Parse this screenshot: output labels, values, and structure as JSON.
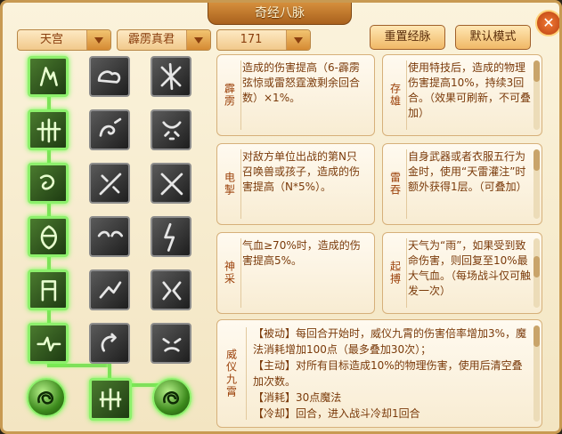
{
  "window": {
    "title": "奇经八脉",
    "close_symbol": "✕"
  },
  "toolbar": {
    "sect": "天宫",
    "school": "霹雳真君",
    "level": "171",
    "reset_button": "重置经脉",
    "default_button": "默认模式"
  },
  "skills": [
    {
      "name": "霹雳",
      "desc": "造成的伤害提高（6-霹雳弦惊或雷怒霆激剩余回合数）×1%。"
    },
    {
      "name": "存雄",
      "desc": "使用特技后，造成的物理伤害提高10%，持续3回合。（效果可刷新，不可叠加）"
    },
    {
      "name": "电掣",
      "desc": "对敌方单位出战的第N只召唤兽或孩子，造成的伤害提高（N*5%）。"
    },
    {
      "name": "雷吞",
      "desc": "自身武器或者衣服五行为金时，使用“天雷灌注”时额外获得1层。（可叠加）"
    },
    {
      "name": "神采",
      "desc": "气血≥70%时，造成的伤害提高5%。"
    },
    {
      "name": "起搏",
      "desc": "天气为“雨”，如果受到致命伤害，则回复至10%最大气血。（每场战斗仅可触发一次）"
    }
  ],
  "main_skill": {
    "name": "威仪九霄",
    "lines": [
      "【被动】每回合开始时，威仪九霄的伤害倍率增加3%，魔法消耗增加100点（最多叠加30次）；",
      "【主动】对所有目标造成10%的物理伤害，使用后清空叠加次数。",
      "【消耗】30点魔法",
      "【冷却】回合，进入战斗冷却1回合"
    ]
  },
  "icons": [
    [
      "lightning-bolt-icon",
      "cloud-icon",
      "crossed-lightning-icon"
    ],
    [
      "pillar-trident-icon",
      "note-claw-icon",
      "demon-face-icon"
    ],
    [
      "swirl-storm-icon",
      "slash-mark-icon",
      "crossed-blades-icon"
    ],
    [
      "spirit-face-icon",
      "eyes-icon",
      "lightning-strike-icon"
    ],
    [
      "gate-pillar-icon",
      "broken-arm-icon",
      "shatter-icon"
    ],
    [
      "heart-pulse-icon",
      "circle-arrow-icon",
      "angry-face-icon"
    ]
  ],
  "active": [
    1,
    1,
    1,
    1,
    1,
    1
  ],
  "colors": {
    "accent": "#9a3f08",
    "active_glow": "#8df06c"
  }
}
